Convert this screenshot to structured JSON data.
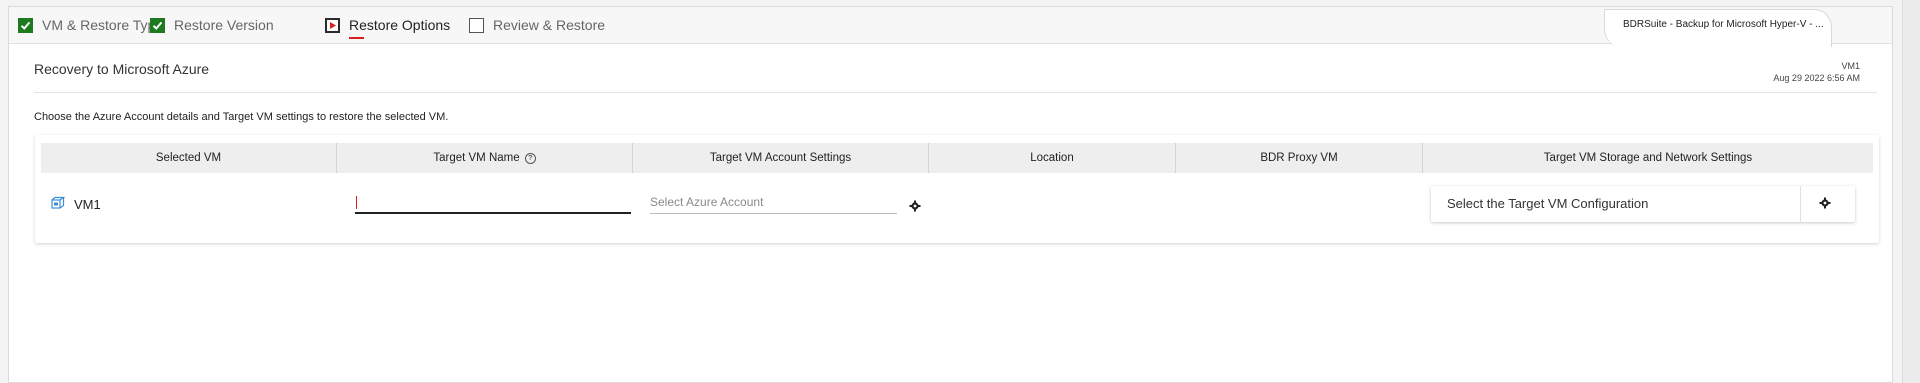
{
  "wizard": {
    "steps": [
      {
        "label": "VM & Restore Type",
        "state": "done"
      },
      {
        "label": "Restore Version",
        "state": "done"
      },
      {
        "label": "Restore Options",
        "state": "current"
      },
      {
        "label": "Review & Restore",
        "state": "pending"
      }
    ],
    "product_tab": "BDRSuite - Backup for Microsoft Hyper-V - ..."
  },
  "page": {
    "title": "Recovery to Microsoft Azure",
    "vm_name": "VM1",
    "timestamp": "Aug 29 2022 6:56 AM",
    "instruction": "Choose the Azure Account details and Target VM settings to restore the selected VM."
  },
  "table": {
    "headers": [
      "Selected VM",
      "Target VM Name",
      "Target VM Account Settings",
      "Location",
      "BDR Proxy VM",
      "Target VM Storage and Network Settings"
    ],
    "help_glyph": "?",
    "row": {
      "selected_vm": "VM1",
      "target_vm_name": "",
      "account_placeholder": "Select Azure Account",
      "location": "",
      "proxy_vm": "",
      "config_label": "Select the Target VM Configuration"
    }
  },
  "colors": {
    "done_check": "#1e7a1e",
    "active_accent": "#d92020",
    "vm_icon": "#3a8fd6"
  },
  "icons": {
    "done": "checkbox-checked-icon",
    "current": "play-square-icon",
    "pending": "checkbox-empty-icon",
    "vm": "vm-icon",
    "settings": "gear-icon"
  }
}
